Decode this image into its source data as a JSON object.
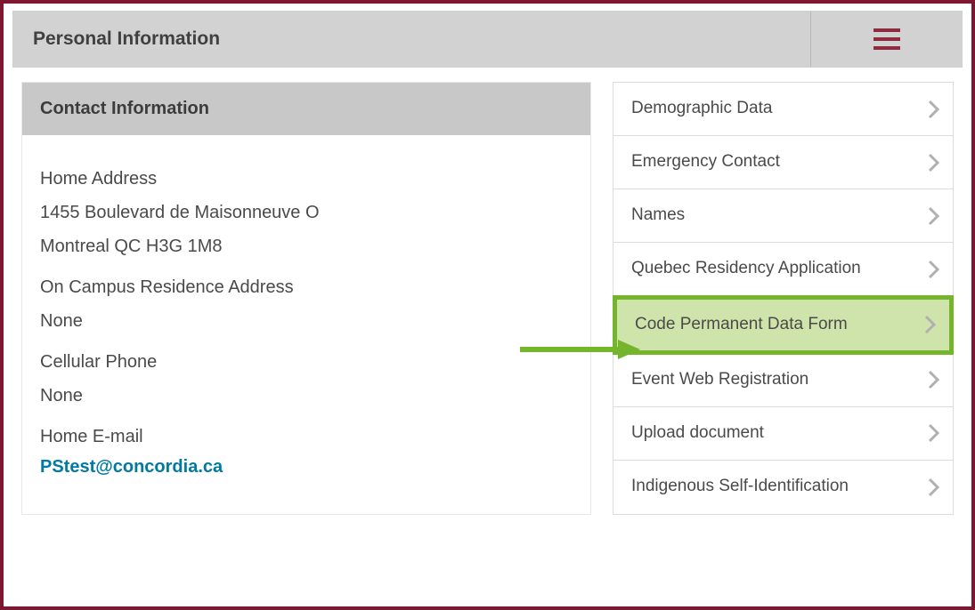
{
  "header": {
    "title": "Personal Information"
  },
  "contact_panel": {
    "title": "Contact Information",
    "home_address_label": "Home Address",
    "home_address_line1": "1455 Boulevard de Maisonneuve O",
    "home_address_line2": "Montreal QC H3G 1M8",
    "campus_label": "On Campus Residence Address",
    "campus_value": "None",
    "cell_label": "Cellular Phone",
    "cell_value": "None",
    "email_label": "Home E-mail",
    "email_value": "PStest@concordia.ca"
  },
  "menu": {
    "items": [
      {
        "label": "Demographic Data",
        "highlight": false
      },
      {
        "label": "Emergency Contact",
        "highlight": false
      },
      {
        "label": "Names",
        "highlight": false
      },
      {
        "label": "Quebec Residency Application",
        "highlight": false
      },
      {
        "label": "Code Permanent Data Form",
        "highlight": true
      },
      {
        "label": "Event Web Registration",
        "highlight": false
      },
      {
        "label": "Upload document",
        "highlight": false
      },
      {
        "label": "Indigenous Self-Identification",
        "highlight": false
      }
    ]
  },
  "colors": {
    "frame_border": "#7e1830",
    "highlight_border": "#75b52b",
    "highlight_fill": "#cfe4aa",
    "link": "#0079a3"
  }
}
